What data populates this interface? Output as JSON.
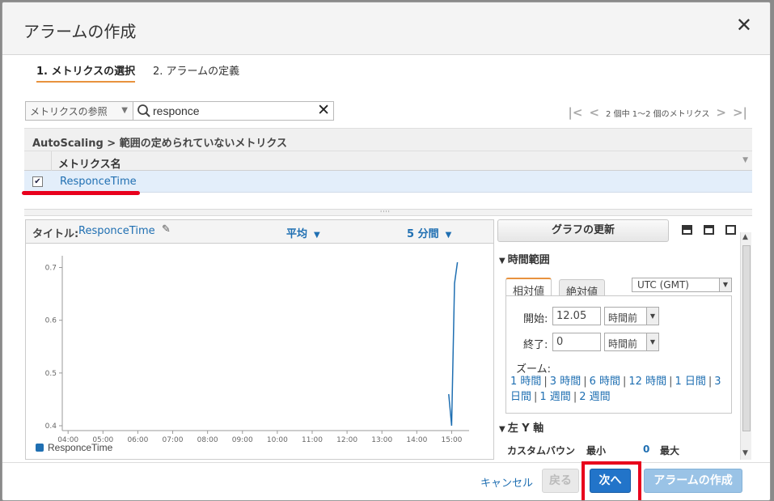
{
  "dialog": {
    "title": "アラームの作成",
    "close_glyph": "✕"
  },
  "steps": [
    {
      "label": "1. メトリクスの選択",
      "active": true
    },
    {
      "label": "2. アラームの定義",
      "active": false
    }
  ],
  "toolbar": {
    "browse_label": "メトリクスの参照",
    "search_value": "responce",
    "pager_text": "2 個中 1～2 個のメトリクス"
  },
  "table": {
    "breadcrumb": "AutoScaling > 範囲の定められていないメトリクス",
    "column_header": "メトリクス名",
    "rows": [
      {
        "name": "ResponceTime",
        "checked": true
      }
    ]
  },
  "graph": {
    "title_label": "タイトル:",
    "title_value": "ResponceTime",
    "statistic": "平均",
    "period": "5 分間"
  },
  "chart_data": {
    "type": "line",
    "x_ticks": [
      "04:00",
      "05:00",
      "06:00",
      "07:00",
      "08:00",
      "09:00",
      "10:00",
      "11:00",
      "12:00",
      "13:00",
      "14:00",
      "15:00"
    ],
    "y_ticks": [
      "0.4",
      "0.5",
      "0.6",
      "0.7"
    ],
    "ylim": [
      0.4,
      0.7
    ],
    "legend": [
      "ResponceTime"
    ],
    "series": [
      {
        "name": "ResponceTime",
        "color": "#1f6fb2",
        "points": [
          {
            "x": "14:55",
            "y": 0.46
          },
          {
            "x": "15:00",
            "y": 0.4
          },
          {
            "x": "15:05",
            "y": 0.67
          },
          {
            "x": "15:10",
            "y": 0.71
          }
        ]
      }
    ]
  },
  "side": {
    "update_button": "グラフの更新",
    "time_range_header": "時間範囲",
    "tabs": [
      "相対値",
      "絶対値"
    ],
    "timezone": "UTC (GMT)",
    "start_label": "開始:",
    "start_value": "12.05",
    "start_unit": "時間前",
    "end_label": "終了:",
    "end_value": "0",
    "end_unit": "時間前",
    "zoom_label": "ズーム:",
    "zoom_options": [
      "1 時間",
      "3 時間",
      "6 時間",
      "12 時間",
      "1 日間",
      "3 日間",
      "1 週間",
      "2 週間"
    ],
    "y_axis_header": "左 Y 軸",
    "custom_bounds_label": "カスタムバウン",
    "min_label": "最小",
    "min_value": "0",
    "max_label": "最大"
  },
  "footer": {
    "cancel": "キャンセル",
    "back": "戻る",
    "next": "次へ",
    "create": "アラームの作成"
  },
  "colors": {
    "accent": "#e8923e",
    "primary": "#2274c9",
    "highlight": "#e8001c",
    "link": "#1f6fb2"
  }
}
